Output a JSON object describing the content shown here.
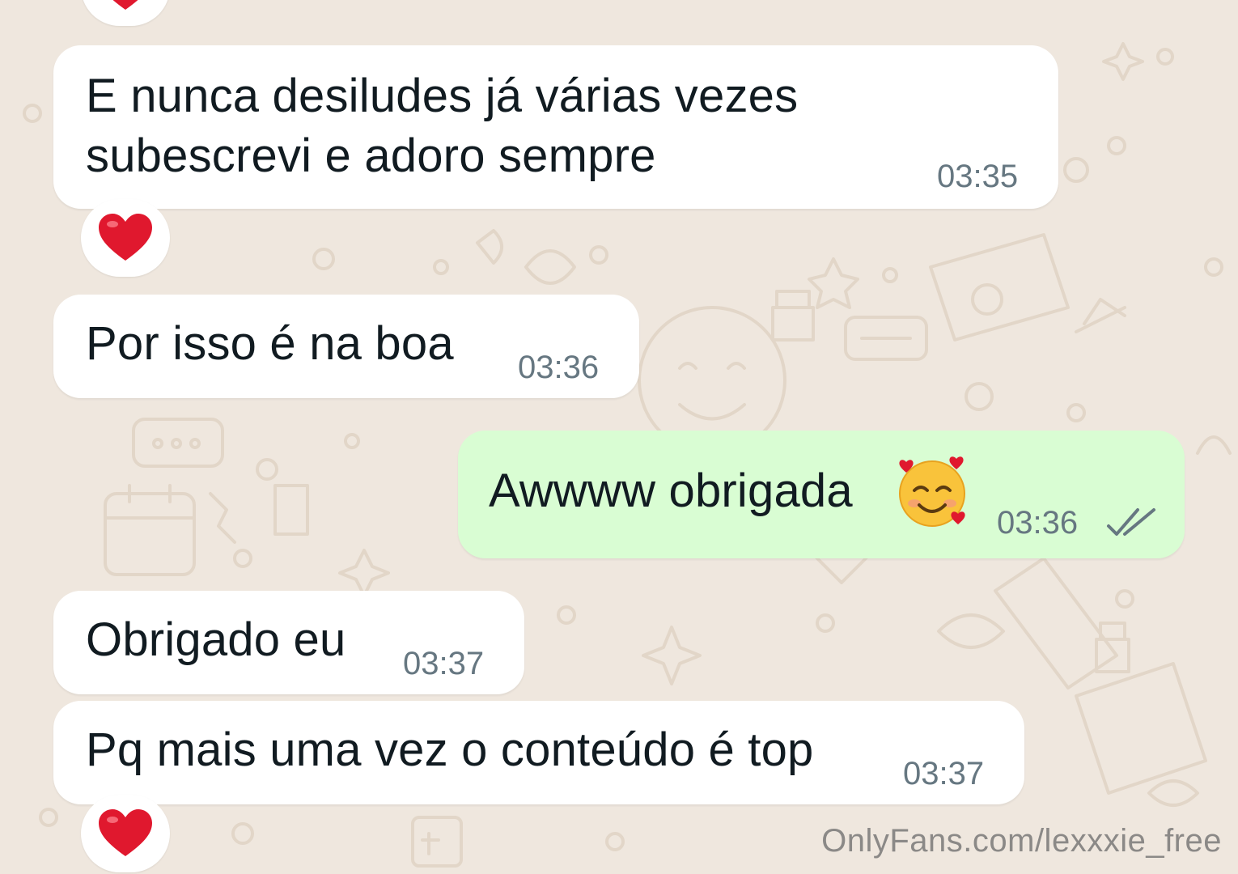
{
  "messages": [
    {
      "direction": "incoming",
      "text": "E nunca desiludes já várias vezes\nsubescrevi e adoro sempre",
      "time": "03:35",
      "reaction": "heart-icon"
    },
    {
      "direction": "incoming",
      "text": "Por isso é na boa",
      "time": "03:36"
    },
    {
      "direction": "outgoing",
      "text": "Awwww obrigada",
      "emoji": "smiling-face-with-hearts-icon",
      "time": "03:36",
      "status": "read"
    },
    {
      "direction": "incoming",
      "text": "Obrigado eu",
      "time": "03:37"
    },
    {
      "direction": "incoming",
      "text": "Pq mais uma vez o conteúdo é top",
      "time": "03:37",
      "reaction": "heart-icon"
    }
  ],
  "watermark": "OnlyFans.com/lexxxie_free",
  "colors": {
    "background": "#efe7de",
    "incoming_bubble": "#ffffff",
    "outgoing_bubble": "#d9fdd3",
    "text": "#111b21",
    "time": "#667781",
    "read_ticks": "#667781",
    "heart": "#e0182e"
  }
}
